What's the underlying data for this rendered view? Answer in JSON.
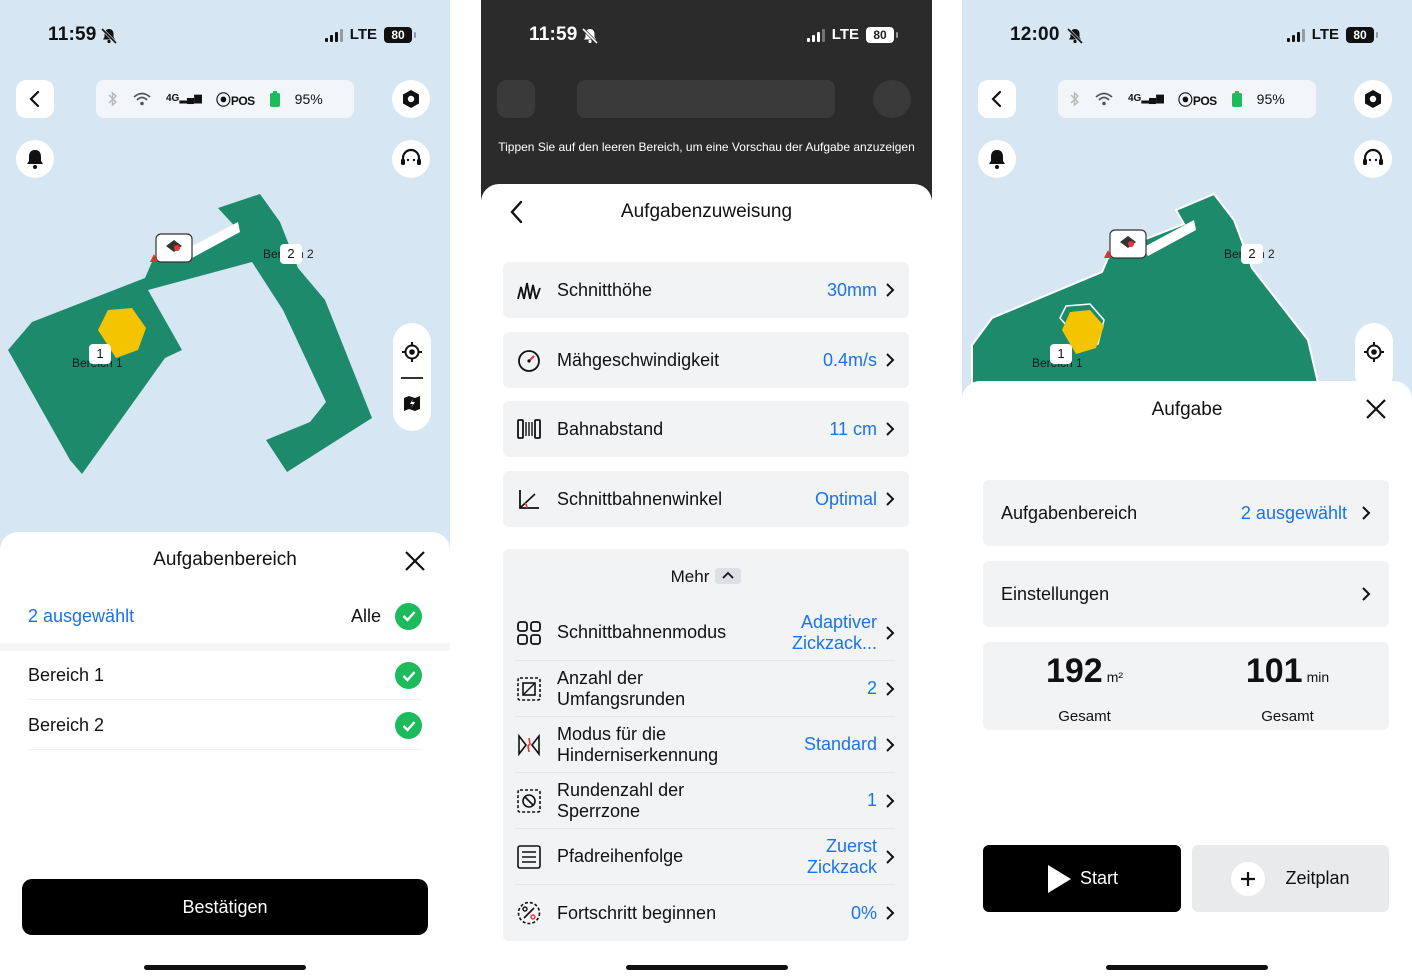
{
  "status": [
    {
      "time": "11:59",
      "network": "LTE",
      "battery": "80"
    },
    {
      "time": "11:59",
      "network": "LTE",
      "battery": "80"
    },
    {
      "time": "12:00",
      "network": "LTE",
      "battery": "80"
    }
  ],
  "device_pill": {
    "pos": "POS",
    "battery_pct": "95%",
    "net": "4G"
  },
  "map": {
    "area1_label": "Bereich 1",
    "area2_label": "Bereich 2",
    "area1_num": "1",
    "area2_num": "2"
  },
  "screen1": {
    "title": "Aufgabenbereich",
    "selected_count": "2 ausgewählt",
    "all_label": "Alle",
    "areas": [
      {
        "label": "Bereich 1"
      },
      {
        "label": "Bereich 2"
      }
    ],
    "confirm_label": "Bestätigen"
  },
  "screen2": {
    "hint": "Tippen Sie auf den leeren Bereich, um eine Vorschau der Aufgabe anzuzeigen",
    "title": "Aufgabenzuweisung",
    "settings": [
      {
        "label": "Schnitthöhe",
        "value": "30mm"
      },
      {
        "label": "Mähgeschwindigkeit",
        "value": "0.4m/s"
      },
      {
        "label": "Bahnabstand",
        "value": "11 cm"
      },
      {
        "label": "Schnittbahnenwinkel",
        "value": "Optimal"
      }
    ],
    "more_label": "Mehr",
    "more": [
      {
        "label": "Schnittbahnenmodus",
        "value": "Adaptiver Zickzack..."
      },
      {
        "label": "Anzahl der Umfangsrunden",
        "value": "2"
      },
      {
        "label": "Modus für die Hinderniserkennung",
        "value": "Standard"
      },
      {
        "label": "Rundenzahl der Sperrzone",
        "value": "1"
      },
      {
        "label": "Pfadreihenfolge",
        "value": "Zuerst Zickzack"
      },
      {
        "label": "Fortschritt beginnen",
        "value": "0%"
      }
    ]
  },
  "screen3": {
    "title": "Aufgabe",
    "task_area_label": "Aufgabenbereich",
    "task_area_value": "2 ausgewählt",
    "settings_label": "Einstellungen",
    "area_value": "192",
    "area_unit": "m²",
    "area_caption": "Gesamt",
    "time_value": "101",
    "time_unit": "min",
    "time_caption": "Gesamt",
    "start_label": "Start",
    "schedule_label": "Zeitplan"
  },
  "colors": {
    "accent": "#1a73e8",
    "lawn": "#1e8a6c",
    "check": "#1dbb5c",
    "map_bg": "#d6e6f2",
    "obstacle": "#f5c400"
  }
}
